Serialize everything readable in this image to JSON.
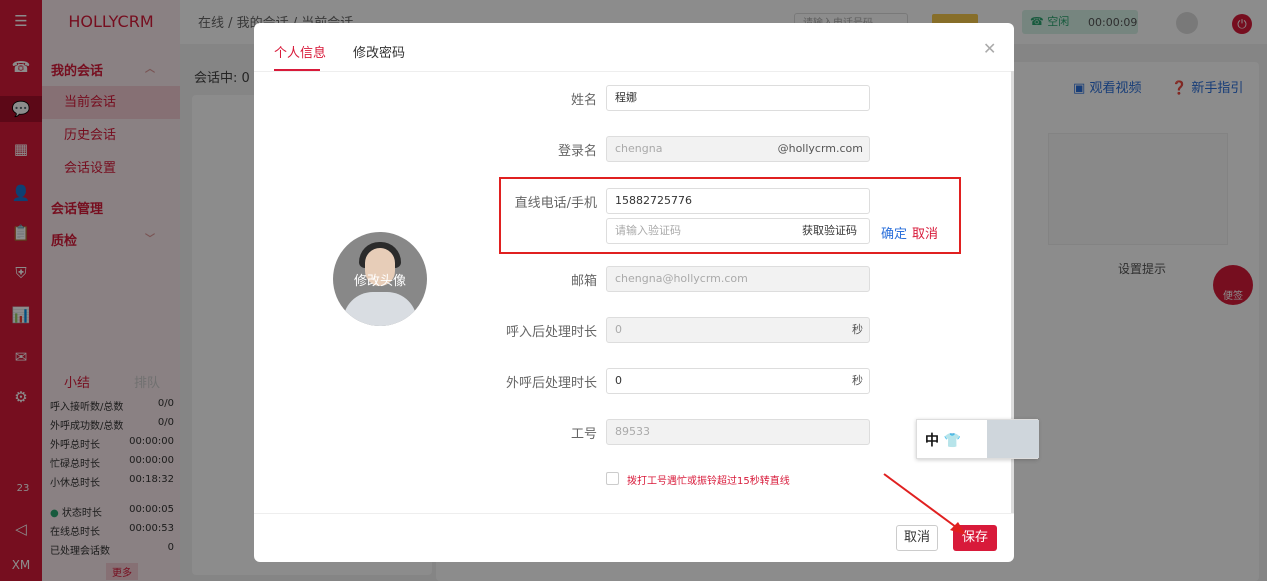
{
  "rail": {
    "icons": [
      "menu-icon",
      "phone-icon",
      "chat-icon",
      "grid-icon",
      "user-icon",
      "clipboard-icon",
      "shield-icon",
      "chart-icon",
      "message-icon",
      "gear-icon"
    ],
    "badge_count": "23",
    "logo": "XM"
  },
  "brand": "HOLLYCRM",
  "sidebar": {
    "my_sessions": "我的会话",
    "current_session": "当前会话",
    "history_session": "历史会话",
    "session_settings": "会话设置",
    "session_management": "会话管理",
    "quality_check": "质检",
    "summary_tab": "小结",
    "queue_tab": "排队",
    "stats": [
      {
        "label": "呼入接听数/总数",
        "value": "0/0"
      },
      {
        "label": "外呼成功数/总数",
        "value": "0/0"
      },
      {
        "label": "外呼总时长",
        "value": "00:00:00"
      },
      {
        "label": "忙碌总时长",
        "value": "00:00:00"
      },
      {
        "label": "小休总时长",
        "value": "00:18:32"
      }
    ],
    "stats2": [
      {
        "label": "状态时长",
        "value": "00:00:05"
      },
      {
        "label": "在线总时长",
        "value": "00:00:53"
      },
      {
        "label": "已处理会话数",
        "value": "0"
      }
    ],
    "more": "更多"
  },
  "topbar": {
    "breadcrumb": "在线 / 我的会话 / 当前会话",
    "search_placeholder": "请输入电话号码",
    "status": "空闲",
    "timer": "00:00:09"
  },
  "main": {
    "session_label": "会话中: 0",
    "watch_video": "观看视频",
    "guide": "新手指引",
    "settings_tip": "设置提示",
    "sticky": "便签"
  },
  "modal": {
    "tab_info": "个人信息",
    "tab_password": "修改密码",
    "avatar_label": "修改头像",
    "name_label": "姓名",
    "name_value": "程娜",
    "login_label": "登录名",
    "login_value": "chengna",
    "login_suffix": "@hollycrm.com",
    "phone_label": "直线电话/手机",
    "phone_value": "15882725776",
    "code_placeholder": "请输入验证码",
    "get_code": "获取验证码",
    "confirm": "确定",
    "cancel_inline": "取消",
    "email_label": "邮箱",
    "email_value": "chengna@hollycrm.com",
    "inbound_label": "呼入后处理时长",
    "inbound_value": "0",
    "outbound_label": "外呼后处理时长",
    "outbound_value": "0",
    "sec_unit": "秒",
    "jobno_label": "工号",
    "jobno_value": "89533",
    "checkbox_label": "拨打工号遇忙或振铃超过15秒转直线",
    "btn_cancel": "取消",
    "btn_save": "保存"
  },
  "ime": {
    "text": "中 👕"
  }
}
